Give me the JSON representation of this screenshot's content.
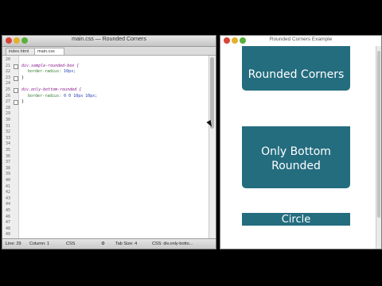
{
  "editor": {
    "title": "main.css — Rounded Corners",
    "tabs": [
      {
        "label": "index.html",
        "active": false
      },
      {
        "label": "main.css",
        "active": true
      }
    ],
    "lines": [
      {
        "n": "20",
        "text": ""
      },
      {
        "n": "21",
        "selector": "div.sample-rounded-box {",
        "fold": true
      },
      {
        "n": "22",
        "prop": "border-radius:",
        "value": " 10px;"
      },
      {
        "n": "23",
        "text": "}",
        "fold": true
      },
      {
        "n": "24",
        "text": ""
      },
      {
        "n": "25",
        "selector": "div.only-bottom-rounded {",
        "fold": true
      },
      {
        "n": "26",
        "prop": "border-radius:",
        "value": " 0 0 10px 10px;"
      },
      {
        "n": "27",
        "text": "}",
        "fold": true
      },
      {
        "n": "28",
        "text": ""
      },
      {
        "n": "29",
        "text": ""
      },
      {
        "n": "30",
        "text": ""
      },
      {
        "n": "31",
        "text": ""
      },
      {
        "n": "32",
        "text": ""
      },
      {
        "n": "33",
        "text": ""
      },
      {
        "n": "34",
        "text": ""
      },
      {
        "n": "35",
        "text": ""
      },
      {
        "n": "36",
        "text": ""
      },
      {
        "n": "37",
        "text": ""
      },
      {
        "n": "38",
        "text": ""
      },
      {
        "n": "39",
        "text": ""
      },
      {
        "n": "40",
        "text": ""
      },
      {
        "n": "41",
        "text": ""
      },
      {
        "n": "42",
        "text": ""
      },
      {
        "n": "43",
        "text": ""
      },
      {
        "n": "44",
        "text": ""
      },
      {
        "n": "45",
        "text": ""
      },
      {
        "n": "46",
        "text": ""
      },
      {
        "n": "47",
        "text": ""
      },
      {
        "n": "48",
        "text": ""
      },
      {
        "n": "49",
        "text": ""
      }
    ],
    "status": {
      "line": "Line: 29",
      "column": "Column: 1",
      "language": "CSS",
      "tab_size": "Tab Size: 4",
      "symbol": "CSS: div.only-botto..."
    }
  },
  "browser": {
    "title": "Rounded Corners Example",
    "boxes": {
      "rounded": "Rounded Corners",
      "bottom": "Only Bottom Rounded",
      "circle": "Circle"
    }
  },
  "colors": {
    "box_fill": "#246d7f"
  }
}
